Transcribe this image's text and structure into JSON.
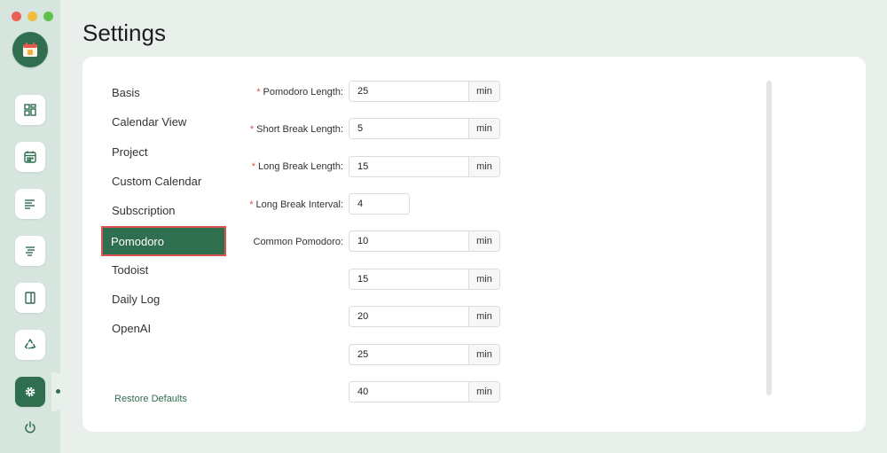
{
  "window": {
    "controls": [
      "close",
      "minimize",
      "maximize"
    ]
  },
  "sidebar": {
    "logo_icon": "calendar-app-icon",
    "buttons": [
      {
        "name": "dashboard-icon",
        "active": false
      },
      {
        "name": "calendar-icon",
        "active": false
      },
      {
        "name": "list-icon",
        "active": false
      },
      {
        "name": "indent-list-icon",
        "active": false
      },
      {
        "name": "panel-icon",
        "active": false
      },
      {
        "name": "recycle-icon",
        "active": false
      },
      {
        "name": "gear-icon",
        "active": true
      }
    ],
    "power_icon": "power-icon"
  },
  "page": {
    "title": "Settings"
  },
  "settings_nav": {
    "items": [
      {
        "label": "Basis"
      },
      {
        "label": "Calendar View"
      },
      {
        "label": "Project"
      },
      {
        "label": "Custom Calendar"
      },
      {
        "label": "Subscription"
      },
      {
        "label": "Pomodoro"
      },
      {
        "label": "Todoist"
      },
      {
        "label": "Daily Log"
      },
      {
        "label": "OpenAI"
      }
    ],
    "active_index": 5,
    "restore_label": "Restore Defaults"
  },
  "form": {
    "required_marker": "*",
    "pomodoro_length": {
      "label": "Pomodoro Length",
      "value": "25",
      "unit": "min",
      "required": true
    },
    "short_break_length": {
      "label": "Short Break Length",
      "value": "5",
      "unit": "min",
      "required": true
    },
    "long_break_length": {
      "label": "Long Break Length",
      "value": "15",
      "unit": "min",
      "required": true
    },
    "long_break_interval": {
      "label": "Long Break Interval",
      "value": "4",
      "required": true
    },
    "common_pomodoro": {
      "label": "Common Pomodoro",
      "unit": "min",
      "values": [
        "10",
        "15",
        "20",
        "25",
        "40"
      ]
    },
    "label_suffix": ":"
  },
  "colors": {
    "accent": "#2f6e4f",
    "required": "#d9534f",
    "highlight_border": "#d9534f",
    "background": "#e9f0ec",
    "rail": "#d6e6de"
  }
}
